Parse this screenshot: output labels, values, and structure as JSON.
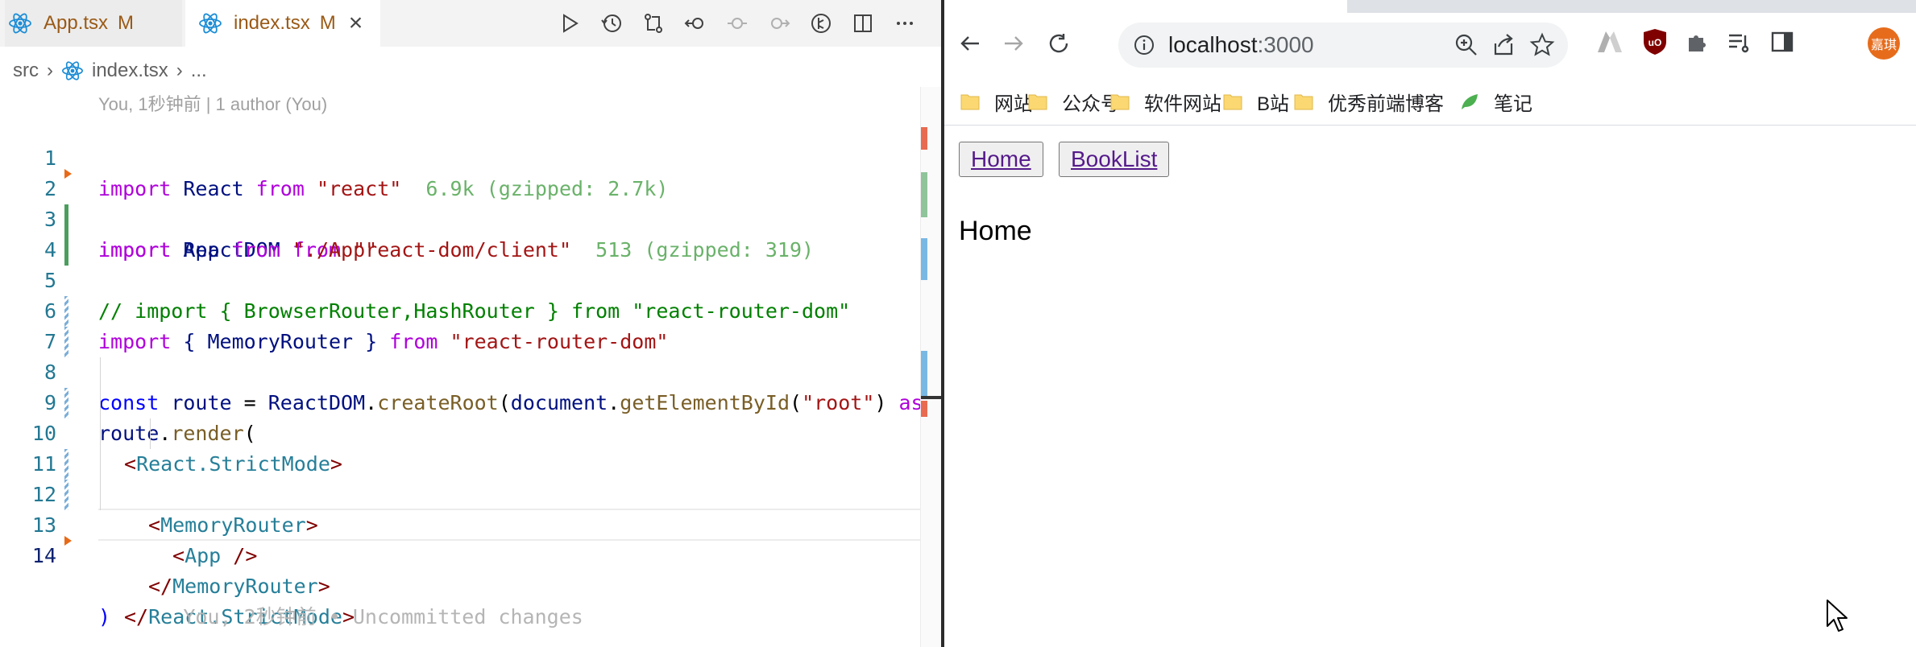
{
  "editor": {
    "tabs": [
      {
        "label": "App.tsx",
        "badge": "M",
        "active": false
      },
      {
        "label": "index.tsx",
        "badge": "M",
        "active": true,
        "close": "×"
      }
    ],
    "breadcrumb": {
      "folder": "src",
      "file": "index.tsx",
      "tail": "..."
    },
    "blame_header": "You, 1秒钟前 | 1 author (You)",
    "tab_actions": [
      "run-icon",
      "timeline-icon",
      "compare-icon",
      "go-back-change-icon",
      "previous-change-icon",
      "next-change-icon",
      "git-graph-icon",
      "split-editor-icon",
      "more-icon"
    ],
    "lines": {
      "l1": {
        "n": "1",
        "t1": "import",
        "t2": " React ",
        "t3": "from",
        "t4": " \"react\"",
        "sz": "6.9k (gzipped: 2.7k)"
      },
      "l2": {
        "n": "2",
        "t1": "import",
        "t2": " ReactDOM ",
        "t3": "from",
        "t4": " \"react-dom/client\"",
        "sz": "513 (gzipped: 319)"
      },
      "l3": {
        "n": "3",
        "t1": "import",
        "t2": " App ",
        "t3": "from",
        "t4": " \"./App\""
      },
      "l4": {
        "n": "4",
        "text": "// import { BrowserRouter,HashRouter } from \"react-router-dom\""
      },
      "l5": {
        "n": "5",
        "t1": "import",
        "t2": " { MemoryRouter } ",
        "t3": "from",
        "t4": " \"react-router-dom\""
      },
      "l6": {
        "n": "6"
      },
      "l7": {
        "n": "7",
        "t1": "const",
        "t2": " route",
        "t3": " = ",
        "t4": "ReactDOM",
        "t5": ".",
        "t6": "createRoot",
        "t7": "(",
        "t8": "document",
        "t9": ".",
        "t10": "getElementById",
        "t11": "(",
        "t12": "\"root\"",
        "t13": ") ",
        "t14": "as"
      },
      "l8": {
        "n": "8",
        "t1": "route",
        "t2": ".",
        "t3": "render",
        "t4": "("
      },
      "l9": {
        "n": "9",
        "t1": "<",
        "t2": "React.StrictMode",
        "t3": ">"
      },
      "l10": {
        "n": "10",
        "t1": "<",
        "t2": "MemoryRouter",
        "t3": ">"
      },
      "l11": {
        "n": "11",
        "t1": "<",
        "t2": "App",
        "t3": " />"
      },
      "l12": {
        "n": "12",
        "t1": "</",
        "t2": "MemoryRouter",
        "t3": ">"
      },
      "l13": {
        "n": "13",
        "t1": "</",
        "t2": "React.StrictMode",
        "t3": ">"
      },
      "l14": {
        "n": "14",
        "t1": ")",
        "ghost": "You, 2秒钟前 • Uncommitted changes"
      }
    },
    "colors": {
      "added": "#4b9e5e",
      "modified": "#7aaed8",
      "deleted": "#e86a17"
    }
  },
  "browser": {
    "url_host": "localhost",
    "url_port": ":3000",
    "nav_icons": [
      "back-icon",
      "forward-icon",
      "reload-icon"
    ],
    "avatar_text": "嘉琪",
    "bookmarks": [
      "网站",
      "公众号",
      "软件网站",
      "B站",
      "优秀前端博客",
      "笔记"
    ],
    "page": {
      "buttons": [
        "Home",
        "BookList"
      ],
      "heading": "Home"
    },
    "link_color": "#551a8b",
    "avatar_color": "#e66c1c"
  }
}
